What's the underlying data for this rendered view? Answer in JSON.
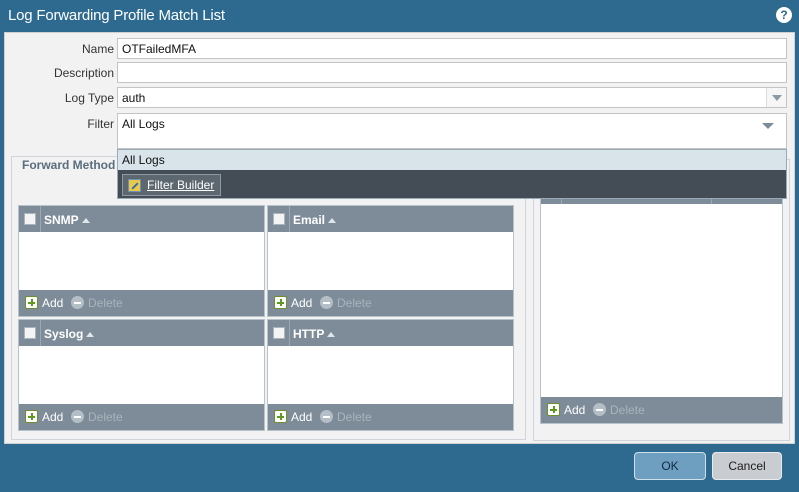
{
  "dialog": {
    "title": "Log Forwarding Profile Match List",
    "help_icon": "?"
  },
  "form": {
    "name_label": "Name",
    "name_value": "OTFailedMFA",
    "description_label": "Description",
    "description_value": "",
    "log_type_label": "Log Type",
    "log_type_value": "auth",
    "filter_label": "Filter",
    "filter_value": "All Logs"
  },
  "filter_dropdown": {
    "option_all_logs": "All Logs",
    "filter_builder_label": "Filter Builder"
  },
  "forward_method": {
    "title": "Forward Method",
    "grids": [
      {
        "header": "SNMP",
        "add_label": "Add",
        "delete_label": "Delete"
      },
      {
        "header": "Email",
        "add_label": "Add",
        "delete_label": "Delete"
      },
      {
        "header": "Syslog",
        "add_label": "Add",
        "delete_label": "Delete"
      },
      {
        "header": "HTTP",
        "add_label": "Add",
        "delete_label": "Delete"
      }
    ]
  },
  "right_panel": {
    "add_label": "Add",
    "delete_label": "Delete"
  },
  "footer": {
    "ok_label": "OK",
    "cancel_label": "Cancel"
  },
  "colors": {
    "titlebar": "#2e6a90",
    "grid_header": "#7d8c98",
    "dropdown_bg": "#444d55",
    "ok_button": "#6f9fc0"
  },
  "icons": {
    "help": "help-icon",
    "combo": "chevron-down-icon",
    "add": "plus-icon",
    "delete": "minus-icon",
    "filter_builder": "pencil-icon"
  }
}
